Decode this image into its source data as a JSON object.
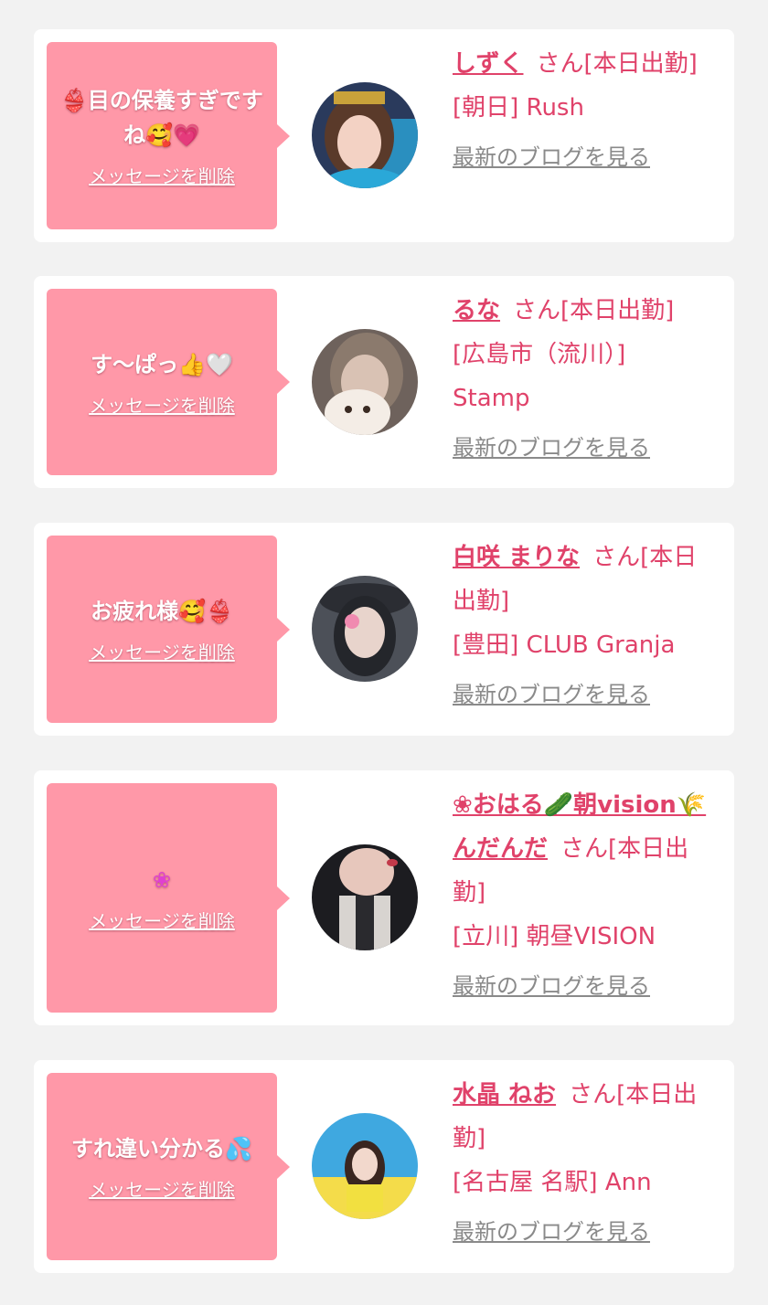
{
  "colors": {
    "background": "#f2f2f2",
    "card": "#ffffff",
    "bubble": "#ff98a8",
    "accent": "#e0426a",
    "link_gray": "#8a8a8a"
  },
  "delete_label": "メッセージを削除",
  "san_suffix": "さん[本日出勤]",
  "blog_label": "最新のブログを見る",
  "items": [
    {
      "message": "👙目の保養すぎですね🥰💗",
      "name": "しずく",
      "shop": "[朝日] Rush"
    },
    {
      "message": "す〜ぱっ👍🤍",
      "name": "るな",
      "shop": "[広島市（流川）] Stamp"
    },
    {
      "message": "お疲れ様🥰👙",
      "name": "白咲 まりな",
      "shop": "[豊田] CLUB Granja"
    },
    {
      "message": "❀",
      "name": "❀おはる🥒朝vision🌾んだんだ",
      "shop": "[立川] 朝昼VISION"
    },
    {
      "message": "すれ違い分かる💦",
      "name": "水晶 ねお",
      "shop": "[名古屋 名駅] Ann"
    }
  ]
}
